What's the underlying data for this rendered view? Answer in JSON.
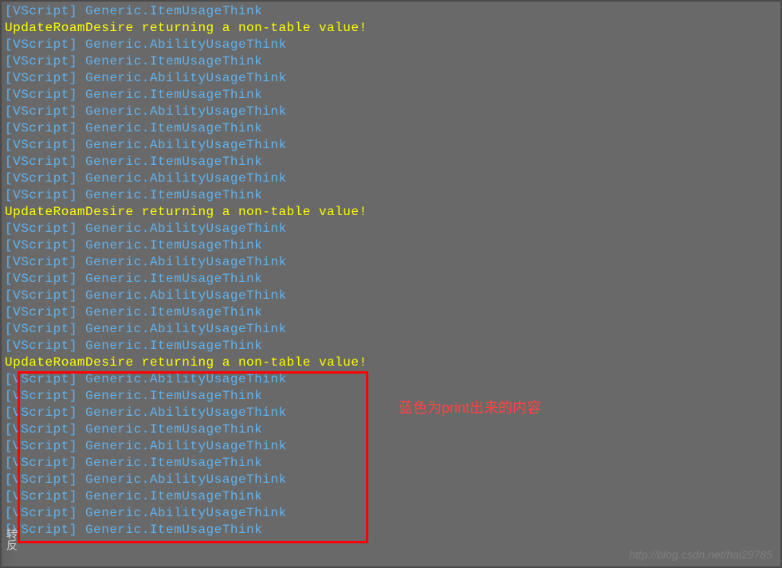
{
  "console": {
    "lines": [
      {
        "type": "blue",
        "text": "[VScript] Generic.ItemUsageThink"
      },
      {
        "type": "yellow",
        "text": "UpdateRoamDesire returning a non-table value!"
      },
      {
        "type": "blue",
        "text": "[VScript] Generic.AbilityUsageThink"
      },
      {
        "type": "blue",
        "text": "[VScript] Generic.ItemUsageThink"
      },
      {
        "type": "blue",
        "text": "[VScript] Generic.AbilityUsageThink"
      },
      {
        "type": "blue",
        "text": "[VScript] Generic.ItemUsageThink"
      },
      {
        "type": "blue",
        "text": "[VScript] Generic.AbilityUsageThink"
      },
      {
        "type": "blue",
        "text": "[VScript] Generic.ItemUsageThink"
      },
      {
        "type": "blue",
        "text": "[VScript] Generic.AbilityUsageThink"
      },
      {
        "type": "blue",
        "text": "[VScript] Generic.ItemUsageThink"
      },
      {
        "type": "blue",
        "text": "[VScript] Generic.AbilityUsageThink"
      },
      {
        "type": "blue",
        "text": "[VScript] Generic.ItemUsageThink"
      },
      {
        "type": "yellow",
        "text": "UpdateRoamDesire returning a non-table value!"
      },
      {
        "type": "blue",
        "text": "[VScript] Generic.AbilityUsageThink"
      },
      {
        "type": "blue",
        "text": "[VScript] Generic.ItemUsageThink"
      },
      {
        "type": "blue",
        "text": "[VScript] Generic.AbilityUsageThink"
      },
      {
        "type": "blue",
        "text": "[VScript] Generic.ItemUsageThink"
      },
      {
        "type": "blue",
        "text": "[VScript] Generic.AbilityUsageThink"
      },
      {
        "type": "blue",
        "text": "[VScript] Generic.ItemUsageThink"
      },
      {
        "type": "blue",
        "text": "[VScript] Generic.AbilityUsageThink"
      },
      {
        "type": "blue",
        "text": "[VScript] Generic.ItemUsageThink"
      },
      {
        "type": "yellow",
        "text": "UpdateRoamDesire returning a non-table value!"
      },
      {
        "type": "blue",
        "text": "[VScript] Generic.AbilityUsageThink"
      },
      {
        "type": "blue",
        "text": "[VScript] Generic.ItemUsageThink"
      },
      {
        "type": "blue",
        "text": "[VScript] Generic.AbilityUsageThink"
      },
      {
        "type": "blue",
        "text": "[VScript] Generic.ItemUsageThink"
      },
      {
        "type": "blue",
        "text": "[VScript] Generic.AbilityUsageThink"
      },
      {
        "type": "blue",
        "text": "[VScript] Generic.ItemUsageThink"
      },
      {
        "type": "blue",
        "text": "[VScript] Generic.AbilityUsageThink"
      },
      {
        "type": "blue",
        "text": "[VScript] Generic.ItemUsageThink"
      },
      {
        "type": "blue",
        "text": "[VScript] Generic.AbilityUsageThink"
      },
      {
        "type": "blue",
        "text": "[VScript] Generic.ItemUsageThink"
      }
    ]
  },
  "annotation": {
    "text": "蓝色为print出来的内容"
  },
  "watermark": {
    "text": "http://blog.csdn.net/hai29785"
  },
  "side": {
    "text": "转反"
  }
}
